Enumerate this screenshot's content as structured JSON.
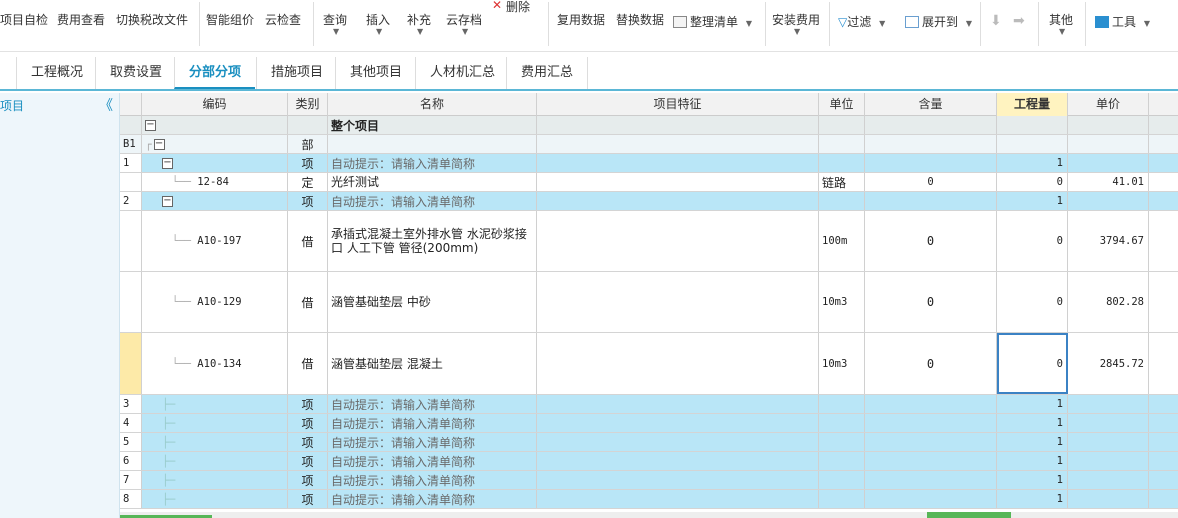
{
  "toolbar": {
    "project_check": "项目自检",
    "fee_view": "费用查看",
    "switch_tax": "切换税改文件",
    "smart_price": "智能组价",
    "cloud_check": "云检查",
    "query": "查询",
    "insert": "插入",
    "supplement": "补充",
    "cloud_save": "云存档",
    "delete": "删除",
    "reuse": "复用数据",
    "replace": "替换数据",
    "organize": "整理清单",
    "install_fee": "安装费用",
    "filter": "过滤",
    "expand": "展开到",
    "other": "其他",
    "tools": "工具"
  },
  "tabs": [
    "工程概况",
    "取费设置",
    "分部分项",
    "措施项目",
    "其他项目",
    "人材机汇总",
    "费用汇总"
  ],
  "left_pane": {
    "title": "项目",
    "collapse": "《"
  },
  "columns": [
    "编码",
    "类别",
    "名称",
    "项目特征",
    "单位",
    "含量",
    "工程量",
    "单价"
  ],
  "rows": [
    {
      "no": "",
      "code": "",
      "type": "",
      "name": "整个项目",
      "unit": "",
      "content": "",
      "qty": "",
      "price": ""
    },
    {
      "no": "B1",
      "code": "",
      "type": "部",
      "name": "",
      "unit": "",
      "content": "",
      "qty": "",
      "price": ""
    },
    {
      "no": "1",
      "code": "",
      "type": "项",
      "name": "自动提示：请输入清单简称",
      "unit": "",
      "content": "",
      "qty": "1",
      "price": ""
    },
    {
      "no": "",
      "code": "12-84",
      "type": "定",
      "name": "光纤测试",
      "unit": "链路",
      "content": "0",
      "qty": "0",
      "price": "41.01"
    },
    {
      "no": "2",
      "code": "",
      "type": "项",
      "name": "自动提示：请输入清单简称",
      "unit": "",
      "content": "",
      "qty": "1",
      "price": ""
    },
    {
      "no": "",
      "code": "A10-197",
      "type": "借",
      "name": "承插式混凝土室外排水管 水泥砂浆接口 人工下管 管径(200mm)",
      "unit": "100m",
      "content": "0",
      "qty": "0",
      "price": "3794.67"
    },
    {
      "no": "",
      "code": "A10-129",
      "type": "借",
      "name": "涵管基础垫层 中砂",
      "unit": "10m3",
      "content": "0",
      "qty": "0",
      "price": "802.28"
    },
    {
      "no": "",
      "code": "A10-134",
      "type": "借",
      "name": "涵管基础垫层 混凝土",
      "unit": "10m3",
      "content": "0",
      "qty": "0",
      "price": "2845.72"
    },
    {
      "no": "3",
      "code": "",
      "type": "项",
      "name": "自动提示：请输入清单简称",
      "unit": "",
      "content": "",
      "qty": "1",
      "price": ""
    },
    {
      "no": "4",
      "code": "",
      "type": "项",
      "name": "自动提示：请输入清单简称",
      "unit": "",
      "content": "",
      "qty": "1",
      "price": ""
    },
    {
      "no": "5",
      "code": "",
      "type": "项",
      "name": "自动提示：请输入清单简称",
      "unit": "",
      "content": "",
      "qty": "1",
      "price": ""
    },
    {
      "no": "6",
      "code": "",
      "type": "项",
      "name": "自动提示：请输入清单简称",
      "unit": "",
      "content": "",
      "qty": "1",
      "price": ""
    },
    {
      "no": "7",
      "code": "",
      "type": "项",
      "name": "自动提示：请输入清单简称",
      "unit": "",
      "content": "",
      "qty": "1",
      "price": ""
    },
    {
      "no": "8",
      "code": "",
      "type": "项",
      "name": "自动提示：请输入清单简称",
      "unit": "",
      "content": "",
      "qty": "1",
      "price": ""
    }
  ]
}
